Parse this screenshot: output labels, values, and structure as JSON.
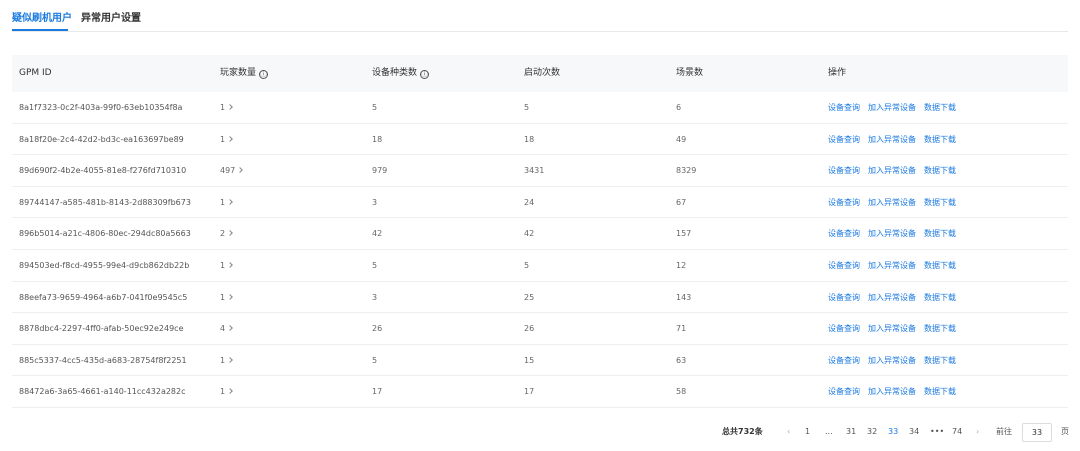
{
  "tabs": [
    {
      "label": "疑似刷机用户",
      "active": true
    },
    {
      "label": "异常用户设置",
      "active": false
    }
  ],
  "table": {
    "headers": [
      "GPM ID",
      "玩家数量",
      "设备种类数",
      "启动次数",
      "场景数",
      "操作"
    ],
    "info_icon": "ⓘ",
    "actions": [
      "设备查询",
      "加入异常设备",
      "数据下载"
    ],
    "rows": [
      {
        "id": "8a1f7323-0c2f-403a-99f0-63eb10354f8a",
        "players": "1",
        "device_types": "5",
        "launches": "5",
        "scenes": "6"
      },
      {
        "id": "8a18f20e-2c4-42d2-bd3c-ea163697be89",
        "players": "1",
        "device_types": "18",
        "launches": "18",
        "scenes": "49"
      },
      {
        "id": "89d690f2-4b2e-4055-81e8-f276fd710310",
        "players": "497",
        "device_types": "979",
        "launches": "3431",
        "scenes": "8329"
      },
      {
        "id": "89744147-a585-481b-8143-2d88309fb673",
        "players": "1",
        "device_types": "3",
        "launches": "24",
        "scenes": "67"
      },
      {
        "id": "896b5014-a21c-4806-80ec-294dc80a5663",
        "players": "2",
        "device_types": "42",
        "launches": "42",
        "scenes": "157"
      },
      {
        "id": "894503ed-f8cd-4955-99e4-d9cb862db22b",
        "players": "1",
        "device_types": "5",
        "launches": "5",
        "scenes": "12"
      },
      {
        "id": "88eefa73-9659-4964-a6b7-041f0e9545c5",
        "players": "1",
        "device_types": "3",
        "launches": "25",
        "scenes": "143"
      },
      {
        "id": "8878dbc4-2297-4ff0-afab-50ec92e249ce",
        "players": "4",
        "device_types": "26",
        "launches": "26",
        "scenes": "71"
      },
      {
        "id": "885c5337-4cc5-435d-a683-28754f8f2251",
        "players": "1",
        "device_types": "5",
        "launches": "15",
        "scenes": "63"
      },
      {
        "id": "88472a6-3a65-4661-a140-11cc432a282c",
        "players": "1",
        "device_types": "17",
        "launches": "17",
        "scenes": "58"
      }
    ]
  },
  "pagination": {
    "total": "总共732条",
    "prev": "‹",
    "next": "›",
    "pages": [
      "1",
      "...",
      "31",
      "32",
      "33",
      "34",
      "•••",
      "74"
    ],
    "current": "33",
    "goto_label": "前往",
    "goto_value": "33",
    "page_suffix": "页"
  },
  "colors": {
    "accent": "#1a7ae0",
    "header_bg": "#f7f8fa"
  }
}
